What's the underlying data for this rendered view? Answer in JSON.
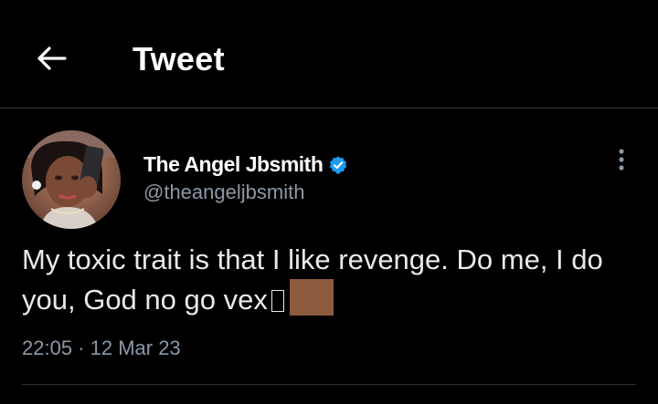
{
  "header": {
    "title": "Tweet",
    "back_icon": "arrow-left-icon"
  },
  "tweet": {
    "author_name": "The Angel Jbsmith",
    "handle": "@theangeljbsmith",
    "verified": true,
    "verified_color": "#1d9bf0",
    "text": "My toxic trait is that I like revenge. Do me, I do you, God no go vex",
    "emoji_icon": "unrendered-emoji-glyph-icon",
    "emoji_skin_tone_color": "#8c5a3c",
    "timestamp": "22:05 · 12 Mar 23",
    "more_icon": "more-vertical-icon",
    "avatar_icon": "profile-photo-avatar"
  },
  "colors": {
    "background": "#000000",
    "text_primary": "#e7e9ea",
    "text_secondary": "#8b98a5",
    "divider": "#2f3336"
  }
}
